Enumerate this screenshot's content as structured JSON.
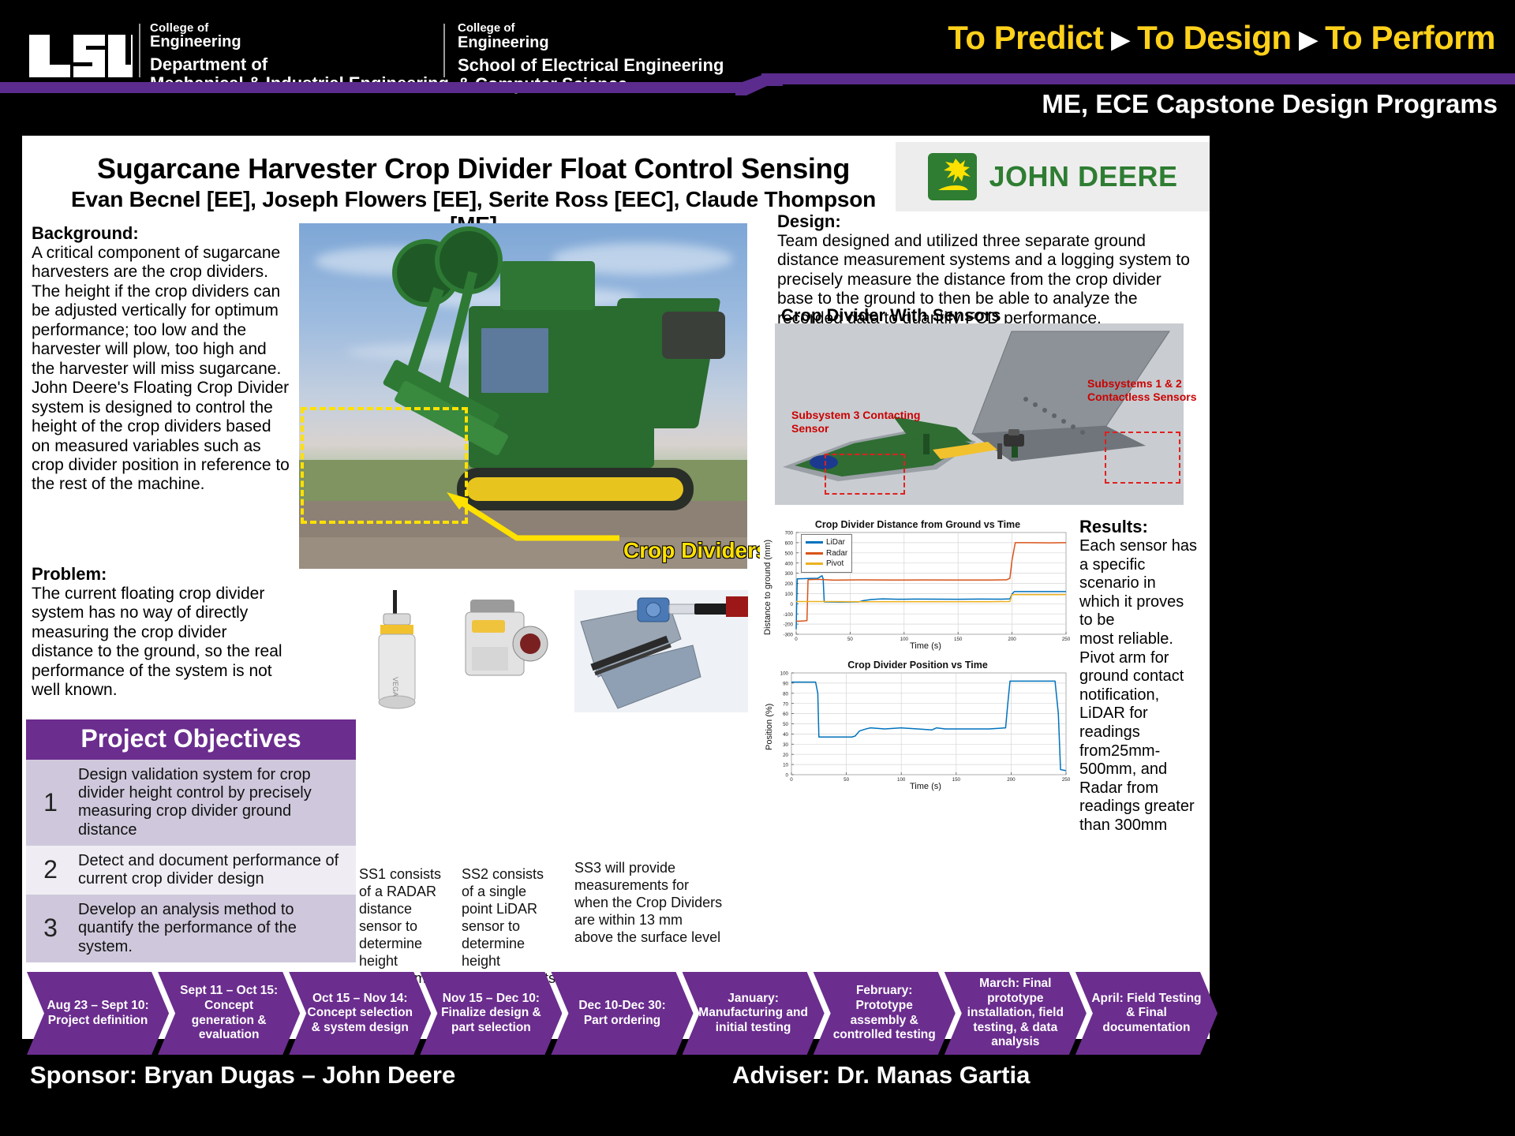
{
  "header": {
    "logo_text": "LSU",
    "dept1": {
      "line1": "College of",
      "line2": "Engineering",
      "line3": "Department of",
      "line4": "Mechanical & Industrial Engineering"
    },
    "dept2": {
      "line1": "College of",
      "line2": "Engineering",
      "line3": "School of Electrical Engineering",
      "line4": "& Computer Science"
    },
    "tagline": {
      "part1": "To Predict",
      "part2": "To Design",
      "part3": "To Perform",
      "separator": "▶"
    },
    "capstone": "ME, ECE Capstone Design Programs",
    "accent_purple": "#5B2C8D",
    "accent_gold": "#FFD11A"
  },
  "poster": {
    "title": "Sugarcane Harvester Crop Divider Float Control Sensing",
    "authors": "Evan Becnel [EE], Joseph Flowers [EE], Serite Ross [EEC], Claude Thompson [ME]",
    "sponsor_logo_text": "JOHN DEERE"
  },
  "background": {
    "heading": "Background:",
    "text": "A critical component of sugarcane harvesters are the crop dividers.  The height if the crop dividers can be adjusted vertically for optimum performance; too low and the harvester will plow, too high and the harvester will miss sugarcane.  John Deere's Floating Crop Divider system is designed to control the height of the crop dividers based on measured variables such as crop divider position in reference to the rest of the machine."
  },
  "problem": {
    "heading": "Problem:",
    "text": "The current floating crop divider system has no way of directly measuring the crop divider distance to the ground, so the real performance of the system is not well known."
  },
  "photo": {
    "callout": "Crop Dividers"
  },
  "objectives": {
    "heading": "Project Objectives",
    "rows": [
      {
        "num": "1",
        "text": "Design validation system for crop divider height control by precisely measuring crop divider ground distance"
      },
      {
        "num": "2",
        "text": "Detect and document performance of current crop divider design"
      },
      {
        "num": "3",
        "text": "Develop an analysis method to quantify the performance of the system."
      }
    ]
  },
  "sensors": [
    {
      "name": "ss1",
      "caption": "SS1 consists of a RADAR distance sensor to determine height measurements"
    },
    {
      "name": "ss2",
      "caption": "SS2 consists of a single point LiDAR sensor to determine height measurements"
    },
    {
      "name": "ss3",
      "caption": "SS3 will provide measurements for when the Crop Dividers\nare within 13 mm above the surface level"
    }
  ],
  "design": {
    "heading": "Design:",
    "text": "Team designed and utilized three separate ground distance measurement systems and a logging system to precisely measure the distance from the crop divider base to the ground to then be able to analyze the recorded data to quantify FCD performance.",
    "diagram_title": "Crop Divider With Sensors",
    "label_subsystem3": "Subsystem 3 Contacting Sensor",
    "label_subsystems12": "Subsystems 1 & 2 Contactless Sensors",
    "label_color": "#CC0000"
  },
  "results": {
    "heading": "Results:",
    "text": "Each sensor has a specific scenario in which it proves to be\nmost  reliable. Pivot arm for ground contact notification, LiDAR for readings from25mm-500mm, and Radar from readings greater than 300mm"
  },
  "chart_data": [
    {
      "type": "line",
      "title": "Crop Divider Distance from Ground vs Time",
      "xlabel": "Time (s)",
      "ylabel": "Distance to ground (mm)",
      "xlim": [
        0,
        250
      ],
      "ylim": [
        -300,
        700
      ],
      "xticks": [
        0,
        50,
        100,
        150,
        200,
        250
      ],
      "yticks": [
        -300,
        -200,
        -100,
        0,
        100,
        200,
        300,
        400,
        500,
        600,
        700
      ],
      "grid": true,
      "legend_position": "top-left",
      "series": [
        {
          "name": "LiDar",
          "color": "#0072BD",
          "x": [
            0,
            1,
            2,
            12,
            20,
            24,
            25,
            26,
            40,
            58,
            62,
            70,
            80,
            95,
            110,
            130,
            150,
            170,
            190,
            198,
            200,
            202,
            215,
            230,
            245,
            250
          ],
          "y": [
            -250,
            245,
            245,
            248,
            250,
            275,
            245,
            18,
            16,
            18,
            30,
            42,
            48,
            44,
            46,
            45,
            44,
            46,
            45,
            48,
            95,
            120,
            120,
            120,
            120,
            120
          ]
        },
        {
          "name": "Radar",
          "color": "#D95319",
          "x": [
            0,
            2,
            8,
            10,
            11,
            20,
            35,
            60,
            90,
            120,
            150,
            180,
            195,
            198,
            200,
            203,
            215,
            235,
            250
          ],
          "y": [
            -170,
            -172,
            -168,
            -165,
            237,
            240,
            232,
            235,
            233,
            234,
            233,
            233,
            235,
            250,
            430,
            600,
            600,
            598,
            600
          ]
        },
        {
          "name": "Pivot",
          "color": "#EDB120",
          "x": [
            0,
            10,
            25,
            60,
            120,
            180,
            198,
            200,
            215,
            250
          ],
          "y": [
            22,
            22,
            22,
            20,
            20,
            20,
            22,
            90,
            90,
            90
          ]
        }
      ]
    },
    {
      "type": "line",
      "title": "Crop Divider Position vs Time",
      "xlabel": "Time (s)",
      "ylabel": "Position (%)",
      "xlim": [
        0,
        250
      ],
      "ylim": [
        0,
        100
      ],
      "xticks": [
        0,
        50,
        100,
        150,
        200,
        250
      ],
      "yticks": [
        0,
        10,
        20,
        30,
        40,
        50,
        60,
        70,
        80,
        90,
        100
      ],
      "grid": true,
      "series": [
        {
          "name": "Position",
          "color": "#0072BD",
          "x": [
            0,
            10,
            22,
            24,
            25,
            40,
            55,
            58,
            62,
            68,
            72,
            85,
            100,
            115,
            128,
            132,
            140,
            160,
            180,
            195,
            197,
            199,
            205,
            225,
            240,
            243,
            245,
            250
          ],
          "y": [
            91,
            91,
            91,
            80,
            37,
            37,
            37,
            38,
            43,
            45,
            46,
            45,
            46,
            45,
            44,
            46,
            45,
            45,
            45,
            46,
            70,
            92,
            92,
            92,
            92,
            60,
            5,
            4
          ]
        }
      ]
    }
  ],
  "timeline": [
    "Aug 23 – Sept 10: Project definition",
    "Sept 11 – Oct 15: Concept generation & evaluation",
    "Oct 15 – Nov 14: Concept selection & system design",
    "Nov 15 – Dec 10: Finalize design & part selection",
    "Dec 10-Dec 30: Part ordering",
    "January: Manufacturing and initial testing",
    "February: Prototype assembly & controlled testing",
    "March: Final prototype installation, field testing, & data analysis",
    "April: Field Testing & Final documentation"
  ],
  "footer": {
    "sponsor": "Sponsor: Bryan Dugas – John Deere",
    "adviser": "Adviser: Dr. Manas Gartia"
  }
}
